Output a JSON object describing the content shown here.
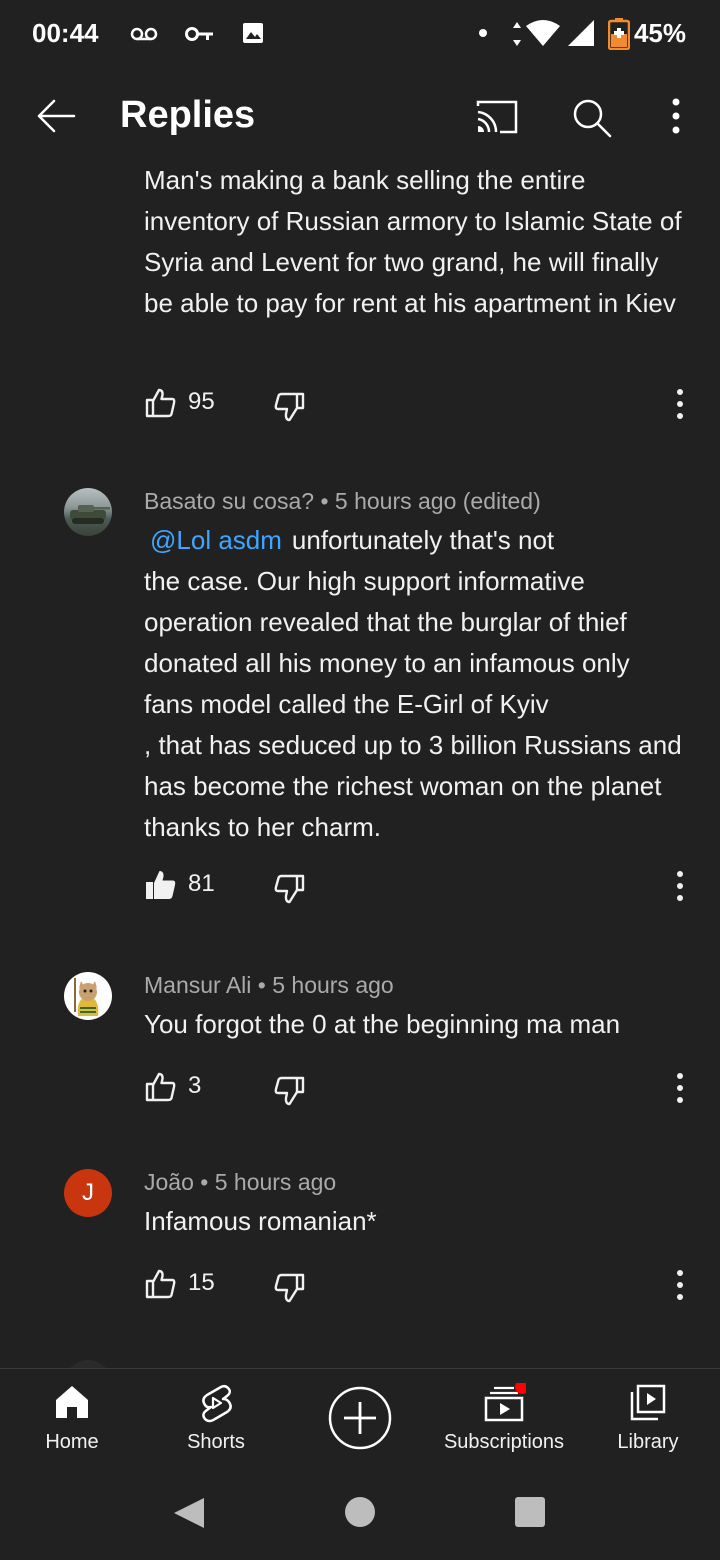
{
  "status_bar": {
    "time": "00:44",
    "battery": "45%"
  },
  "app_bar": {
    "title": "Replies"
  },
  "comments": [
    {
      "author": "",
      "body": "Man's making a bank selling the entire inventory of Russian armory to Islamic State of Syria and Levent for two grand, he will finally be able to pay for rent at his apartment in Kiev",
      "likes": "95"
    },
    {
      "author": "Basato su cosa?",
      "time": "5 hours ago (edited)",
      "mention": "@Lol asdm",
      "body_line1": "unfortunately that's not",
      "body_rest": "the case. Our high support informative operation revealed that the burglar of thief donated all his money to an infamous only fans model called the E-Girl of Kyiv",
      "body_line_b": ", that has seduced up to 3 billion Russians and has become the richest woman on the planet thanks to her charm.",
      "likes": "81"
    },
    {
      "author": "Mansur Ali",
      "time": "5 hours ago",
      "body": "You forgot the 0 at the beginning ma man",
      "likes": "3"
    },
    {
      "author": "João",
      "avatar_letter": "J",
      "time": "5 hours ago",
      "body": "Infamous romanian*",
      "likes": "15"
    }
  ],
  "separator": "•",
  "bottom_nav": {
    "home": "Home",
    "shorts": "Shorts",
    "subscriptions": "Subscriptions",
    "library": "Library"
  },
  "colors": {
    "background": "#212121",
    "mention": "#3ea6ff",
    "notification_dot": "#ff0000",
    "joao_avatar": "#c9350f"
  }
}
